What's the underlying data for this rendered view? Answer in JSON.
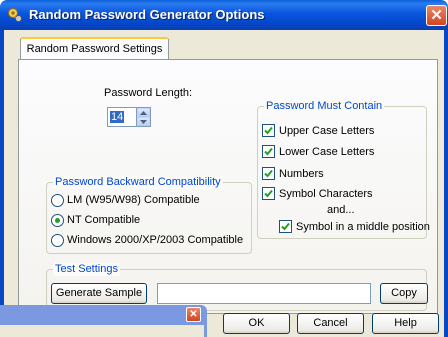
{
  "window": {
    "title": "Random Password Generator Options",
    "close_glyph": "✕",
    "icon": "key-gear-app-icon",
    "accent": "#0046d5",
    "titlebar_color": "#0855dd"
  },
  "tabs": [
    {
      "label": "Random Password Settings",
      "active": true
    }
  ],
  "password_length": {
    "label": "Password Length:",
    "value": "14"
  },
  "compatibility": {
    "title": "Password Backward Compatibility",
    "options": [
      {
        "label": "LM (W95/W98) Compatible",
        "selected": false
      },
      {
        "label": "NT Compatible",
        "selected": true
      },
      {
        "label": "Windows 2000/XP/2003 Compatible",
        "selected": false
      }
    ]
  },
  "must_contain": {
    "title": "Password Must Contain",
    "options": [
      {
        "label": "Upper Case Letters",
        "checked": true
      },
      {
        "label": "Lower Case Letters",
        "checked": true
      },
      {
        "label": "Numbers",
        "checked": true
      },
      {
        "label": "Symbol Characters",
        "checked": true
      }
    ],
    "and_text": "and...",
    "middle_option": {
      "label": "Symbol in a middle position",
      "checked": true
    }
  },
  "test_settings": {
    "title": "Test Settings",
    "generate_label": "Generate Sample",
    "sample_value": "",
    "copy_label": "Copy"
  },
  "buttons": {
    "ok": "OK",
    "cancel": "Cancel",
    "help": "Help"
  },
  "background_window": {
    "close_glyph": "✕"
  }
}
